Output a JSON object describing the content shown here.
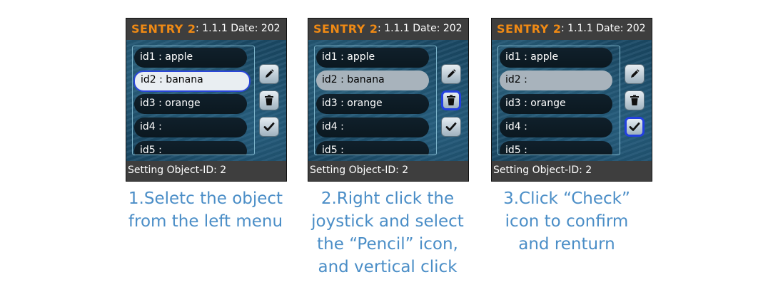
{
  "panels": [
    {
      "brand": "SENTRY 2",
      "version": ": 1.1.1 Date: 202",
      "items": [
        "id1 : apple",
        "id2 : banana",
        "id3 : orange",
        "id4 :",
        "id5 :"
      ],
      "status": "Setting Object-ID: 2",
      "caption": [
        "1.Seletc the object",
        "from the left menu"
      ]
    },
    {
      "brand": "SENTRY 2",
      "version": ": 1.1.1 Date: 202",
      "items": [
        "id1 : apple",
        "id2 : banana",
        "id3 : orange",
        "id4 :",
        "id5 :"
      ],
      "status": "Setting Object-ID: 2",
      "caption": [
        "2.Right click the",
        "joystick and select",
        "the “Pencil” icon,",
        "and vertical click"
      ]
    },
    {
      "brand": "SENTRY 2",
      "version": ": 1.1.1 Date: 202",
      "items": [
        "id1 : apple",
        "id2 :",
        "id3 : orange",
        "id4 :",
        "id5 :"
      ],
      "status": "Setting Object-ID: 2",
      "caption": [
        "3.Click “Check”",
        "icon to confirm",
        "and renturn"
      ]
    }
  ],
  "icons": [
    "pencil-icon",
    "trash-icon",
    "check-icon"
  ],
  "colors": {
    "brand": "#f08a14",
    "caption": "#4b8ec7",
    "highlight": "#2340e0"
  }
}
